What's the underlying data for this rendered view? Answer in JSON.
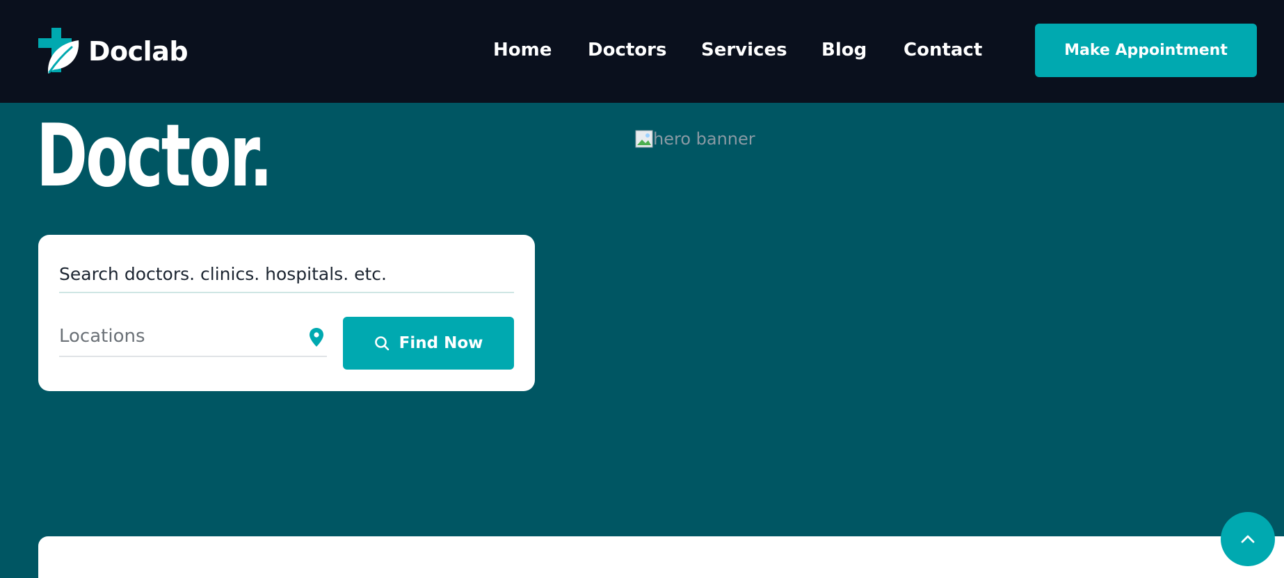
{
  "header": {
    "brand": "Doclab",
    "nav": [
      {
        "label": "Home"
      },
      {
        "label": "Doctors"
      },
      {
        "label": "Services"
      },
      {
        "label": "Blog"
      },
      {
        "label": "Contact"
      }
    ],
    "cta_label": "Make Appointment"
  },
  "hero": {
    "title": "Doctor.",
    "image_alt": "hero banner"
  },
  "search": {
    "query_placeholder": "Search doctors. clinics. hospitals. etc.",
    "location_placeholder": "Locations",
    "button_label": "Find Now"
  },
  "colors": {
    "header_bg": "#0a101d",
    "hero_bg": "#005663",
    "accent": "#00a9b0",
    "leaf": "#ffffff"
  },
  "icons": {
    "logo": "cross-leaf-logo-icon",
    "location": "map-pin-icon",
    "search": "search-icon",
    "scroll_top": "chevron-up-icon",
    "broken_image": "broken-image-icon"
  }
}
